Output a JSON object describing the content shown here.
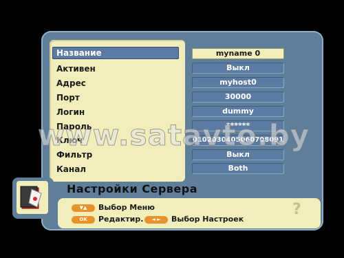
{
  "menu": {
    "title": "Настройки Сервера",
    "rows": [
      {
        "label": "Название",
        "value": "myname  0"
      },
      {
        "label": "Активен",
        "value": "Выкл"
      },
      {
        "label": "Адрес",
        "value": "myhost0"
      },
      {
        "label": "Порт",
        "value": "30000"
      },
      {
        "label": "Логин",
        "value": "dummy"
      },
      {
        "label": "Пароль",
        "value": "******"
      },
      {
        "label": "Ключ",
        "value": "0102030405060708091"
      },
      {
        "label": "Фильтр",
        "value": "Выкл"
      },
      {
        "label": "Канал",
        "value": "Both"
      }
    ],
    "selected_index": 0
  },
  "help": {
    "updown_key": "▼▲",
    "updown_label": "Выбор Меню",
    "ok_key": "OK",
    "ok_label": "Редактир.",
    "leftright_key": "◄ ►",
    "leftright_label": "Выбор Настроек",
    "question": "?"
  },
  "watermark": "www.satavto.by",
  "colors": {
    "panel": "#f1eebb",
    "frame": "#5e7e99",
    "selection": "#5b7ba2",
    "key": "#e8922c"
  },
  "icon": "settings-book-icon"
}
